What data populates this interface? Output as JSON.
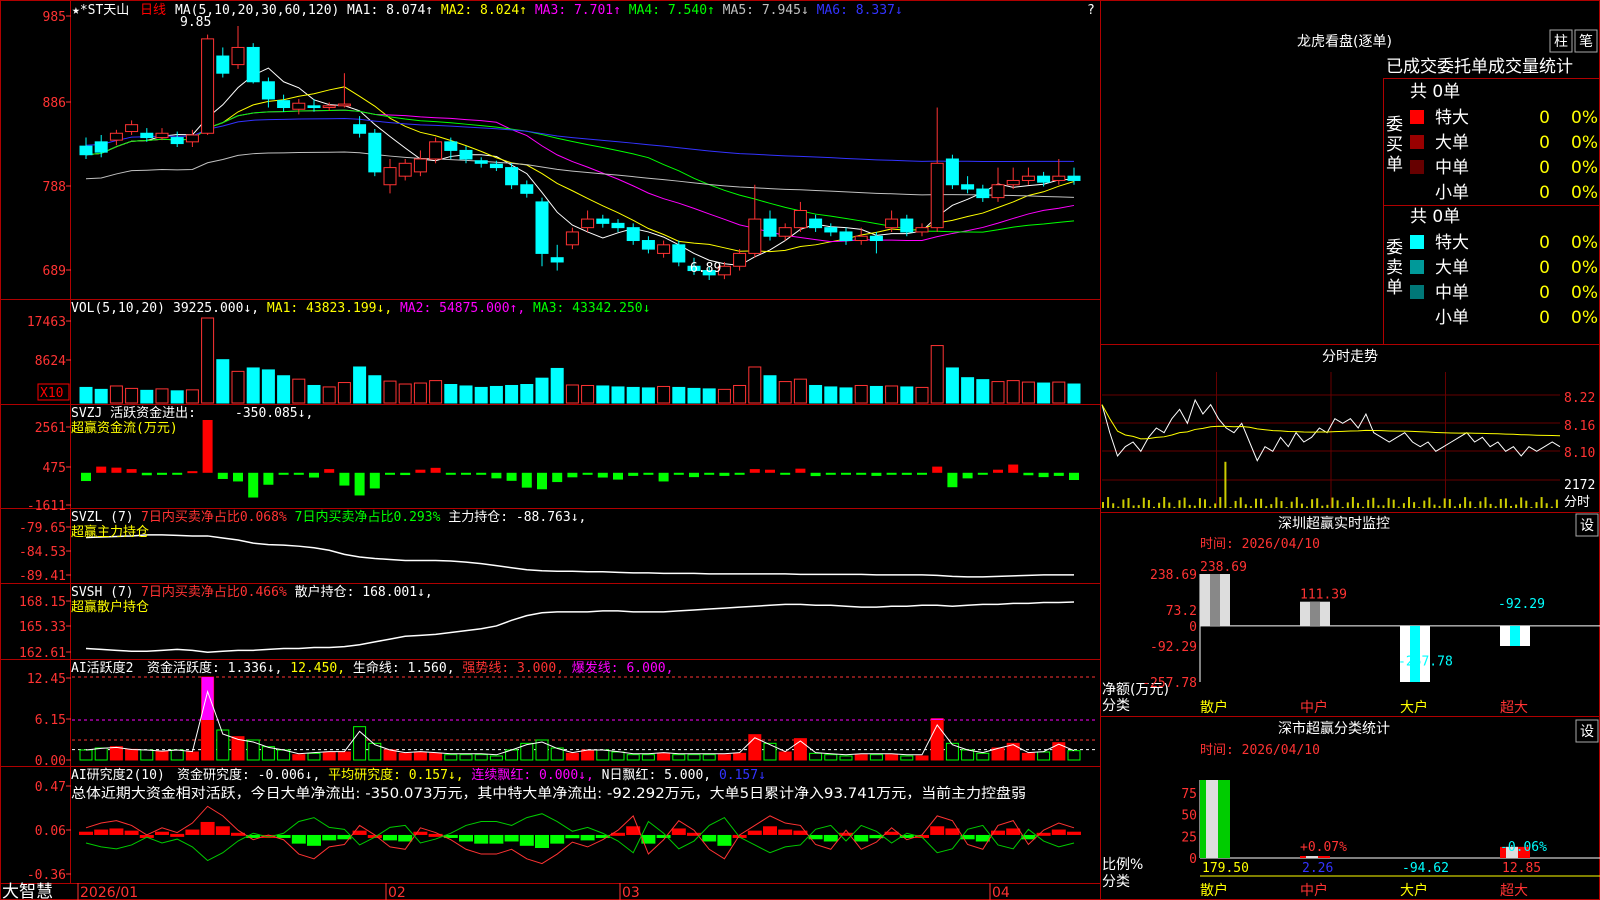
{
  "chart_data": [
    {
      "type": "candlestick",
      "panel": "price",
      "title_prefix": "★*ST天山",
      "period": "日线",
      "ma_label": "MA(5,10,20,30,60,120)",
      "ma_values": [
        {
          "text": "MA1: 8.074↑",
          "color": "#ffffff"
        },
        {
          "text": "MA2: 8.024↑",
          "color": "#ffff00"
        },
        {
          "text": "MA3: 7.701↑",
          "color": "#ff00ff"
        },
        {
          "text": "MA4: 7.540↑",
          "color": "#00ff00"
        },
        {
          "text": "MA5: 7.945↓",
          "color": "#c0c0c0"
        },
        {
          "text": "MA6: 8.337↓",
          "color": "#3333ff"
        }
      ],
      "y_ticks": [
        "985",
        "886",
        "788",
        "689"
      ],
      "y_range": [
        6.89,
        9.85
      ],
      "high_mark": "9.85",
      "low_mark": "6.89",
      "x_labels": [
        "2026/01",
        "02",
        "03",
        "04"
      ],
      "candles": [
        [
          8.45,
          8.35,
          8.55,
          8.3
        ],
        [
          8.5,
          8.38,
          8.58,
          8.32
        ],
        [
          8.52,
          8.6,
          8.64,
          8.46
        ],
        [
          8.62,
          8.7,
          8.75,
          8.58
        ],
        [
          8.6,
          8.55,
          8.66,
          8.5
        ],
        [
          8.55,
          8.6,
          8.66,
          8.52
        ],
        [
          8.55,
          8.48,
          8.62,
          8.44
        ],
        [
          8.5,
          8.58,
          8.64,
          8.44
        ],
        [
          8.6,
          9.7,
          9.75,
          8.58
        ],
        [
          9.5,
          9.3,
          9.6,
          9.25
        ],
        [
          9.4,
          9.6,
          9.85,
          9.35
        ],
        [
          9.6,
          9.2,
          9.65,
          9.18
        ],
        [
          9.2,
          9.0,
          9.25,
          8.9
        ],
        [
          8.98,
          8.9,
          9.05,
          8.85
        ],
        [
          8.88,
          8.95,
          9.0,
          8.82
        ],
        [
          8.92,
          8.9,
          9.0,
          8.85
        ],
        [
          8.9,
          8.92,
          8.96,
          8.86
        ],
        [
          8.92,
          8.94,
          9.3,
          8.9
        ],
        [
          8.7,
          8.6,
          8.8,
          8.55
        ],
        [
          8.6,
          8.15,
          8.65,
          8.1
        ],
        [
          8.0,
          8.2,
          8.3,
          7.9
        ],
        [
          8.1,
          8.25,
          8.3,
          8.05
        ],
        [
          8.15,
          8.3,
          8.4,
          8.1
        ],
        [
          8.3,
          8.5,
          8.55,
          8.25
        ],
        [
          8.5,
          8.4,
          8.55,
          8.3
        ],
        [
          8.4,
          8.3,
          8.45,
          8.25
        ],
        [
          8.28,
          8.25,
          8.32,
          8.2
        ],
        [
          8.24,
          8.2,
          8.28,
          8.16
        ],
        [
          8.2,
          8.0,
          8.25,
          7.95
        ],
        [
          8.0,
          7.9,
          8.05,
          7.85
        ],
        [
          7.8,
          7.2,
          7.85,
          7.05
        ],
        [
          7.15,
          7.1,
          7.3,
          7.0
        ],
        [
          7.3,
          7.45,
          7.5,
          7.25
        ],
        [
          7.5,
          7.6,
          7.7,
          7.45
        ],
        [
          7.6,
          7.55,
          7.65,
          7.5
        ],
        [
          7.55,
          7.5,
          7.6,
          7.45
        ],
        [
          7.5,
          7.35,
          7.55,
          7.3
        ],
        [
          7.35,
          7.25,
          7.4,
          7.2
        ],
        [
          7.2,
          7.3,
          7.35,
          7.15
        ],
        [
          7.3,
          7.1,
          7.35,
          7.05
        ],
        [
          7.05,
          7.0,
          7.15,
          6.95
        ],
        [
          7.0,
          6.95,
          7.05,
          6.89
        ],
        [
          6.95,
          7.05,
          7.1,
          6.9
        ],
        [
          7.05,
          7.2,
          7.25,
          7.0
        ],
        [
          7.2,
          7.6,
          8.0,
          7.15
        ],
        [
          7.6,
          7.4,
          7.7,
          7.35
        ],
        [
          7.4,
          7.5,
          7.55,
          7.35
        ],
        [
          7.5,
          7.7,
          7.8,
          7.45
        ],
        [
          7.6,
          7.5,
          7.65,
          7.45
        ],
        [
          7.5,
          7.45,
          7.55,
          7.4
        ],
        [
          7.45,
          7.35,
          7.5,
          7.3
        ],
        [
          7.35,
          7.4,
          7.5,
          7.3
        ],
        [
          7.4,
          7.35,
          7.45,
          7.2
        ],
        [
          7.5,
          7.6,
          7.7,
          7.45
        ],
        [
          7.6,
          7.45,
          7.65,
          7.4
        ],
        [
          7.45,
          7.5,
          7.55,
          7.4
        ],
        [
          7.5,
          8.25,
          8.9,
          7.45
        ],
        [
          8.3,
          8.0,
          8.35,
          7.95
        ],
        [
          8.0,
          7.95,
          8.1,
          7.9
        ],
        [
          7.95,
          7.85,
          8.0,
          7.8
        ],
        [
          7.85,
          8.0,
          8.2,
          7.8
        ],
        [
          8.0,
          8.05,
          8.2,
          7.95
        ],
        [
          8.05,
          8.1,
          8.2,
          8.0
        ],
        [
          8.1,
          8.03,
          8.15,
          7.98
        ],
        [
          8.05,
          8.1,
          8.3,
          8.0
        ],
        [
          8.1,
          8.05,
          8.2,
          8.0
        ]
      ]
    },
    {
      "type": "bar",
      "panel": "volume",
      "label": "VOL(5,10,20)",
      "segments": [
        {
          "text": "39225.000↓,",
          "color": "#ffffff"
        },
        {
          "text": "MA1: 43823.199↓,",
          "color": "#ffff00"
        },
        {
          "text": "MA2: 54875.000↑,",
          "color": "#ff00ff"
        },
        {
          "text": "MA3: 43342.250↓",
          "color": "#00ff00"
        }
      ],
      "y_ticks": [
        "17463",
        "8624"
      ],
      "unit": "X10",
      "y_range": [
        0,
        17463
      ],
      "values": [
        3200,
        2800,
        3500,
        3000,
        2600,
        2900,
        2500,
        2700,
        17463,
        8900,
        6500,
        7200,
        6800,
        5600,
        4900,
        3600,
        3300,
        4200,
        7400,
        5600,
        4500,
        3900,
        4100,
        4600,
        3800,
        3500,
        3200,
        3400,
        3600,
        3800,
        5100,
        7100,
        3700,
        3600,
        3500,
        3300,
        3200,
        3100,
        3400,
        3200,
        3000,
        2900,
        2800,
        3600,
        7400,
        5600,
        4400,
        4900,
        3600,
        3300,
        3100,
        3600,
        3400,
        3500,
        3300,
        3200,
        11800,
        7200,
        5200,
        4800,
        4400,
        4600,
        4300,
        4100,
        4300,
        3900
      ]
    },
    {
      "type": "bar",
      "panel": "svzj",
      "label": "SVZJ  活跃资金进出:",
      "value_text": "-350.085↓,",
      "subtitle": "超赢资金流(万元)",
      "y_ticks": [
        "2561",
        "475",
        "-1611"
      ],
      "y_range": [
        -1611,
        2561
      ],
      "values": [
        -400,
        300,
        250,
        180,
        -120,
        -100,
        -90,
        80,
        2561,
        -300,
        -420,
        -1200,
        -580,
        -60,
        -50,
        -230,
        180,
        -620,
        -1100,
        -760,
        -60,
        -110,
        150,
        240,
        -40,
        -60,
        -60,
        -270,
        -390,
        -720,
        -800,
        -450,
        -220,
        -90,
        -230,
        -330,
        -150,
        -70,
        -420,
        -60,
        -210,
        -60,
        -150,
        -90,
        180,
        150,
        -60,
        200,
        -160,
        -90,
        -70,
        -60,
        -150,
        -80,
        -100,
        -60,
        300,
        -700,
        -270,
        -50,
        150,
        400,
        -120,
        -210,
        -150,
        -350
      ]
    },
    {
      "type": "line",
      "panel": "svzl",
      "label": "SVZL (7)",
      "segments": [
        {
          "text": "7日内买卖净占比0.068%",
          "color": "#ff3333"
        },
        {
          "text": "7日内买卖净占比0.293%",
          "color": "#00ff00"
        },
        {
          "text": "主力持仓: -88.763↓,",
          "color": "#ffffff"
        }
      ],
      "subtitle": "超赢主力持仓",
      "y_ticks": [
        "-79.65",
        "-84.53",
        "-89.41"
      ],
      "y_range": [
        -89.41,
        -79.65
      ],
      "values": [
        -81.5,
        -81.4,
        -81.3,
        -81.2,
        -81.0,
        -81.0,
        -81.1,
        -81.2,
        -81.2,
        -81.6,
        -82.0,
        -82.6,
        -82.9,
        -83.0,
        -83.2,
        -83.5,
        -84.0,
        -84.8,
        -85.3,
        -85.6,
        -85.8,
        -86.0,
        -86.0,
        -86.0,
        -86.1,
        -86.3,
        -86.6,
        -87.0,
        -87.4,
        -87.8,
        -88.0,
        -88.1,
        -88.1,
        -88.2,
        -88.2,
        -88.3,
        -88.4,
        -88.4,
        -88.5,
        -88.5,
        -88.5,
        -88.6,
        -88.6,
        -88.6,
        -88.6,
        -88.6,
        -88.6,
        -88.7,
        -88.7,
        -88.7,
        -88.7,
        -88.7,
        -88.8,
        -88.8,
        -88.8,
        -88.8,
        -88.9,
        -89.1,
        -89.2,
        -89.2,
        -89.1,
        -89.0,
        -88.9,
        -88.8,
        -88.8,
        -88.8
      ]
    },
    {
      "type": "line",
      "panel": "svsh",
      "label": "SVSH (7)",
      "segments": [
        {
          "text": "7日内买卖净占比0.466%",
          "color": "#ff3333"
        },
        {
          "text": "散户持仓: 168.001↓,",
          "color": "#ffffff"
        }
      ],
      "subtitle": "超赢散户持仓",
      "y_ticks": [
        "168.15",
        "165.33",
        "162.61"
      ],
      "y_range": [
        162.61,
        168.15
      ],
      "values": [
        163.2,
        163.1,
        163.0,
        162.9,
        162.9,
        163.0,
        163.1,
        163.0,
        162.8,
        162.9,
        163.0,
        163.0,
        163.1,
        163.2,
        163.2,
        163.3,
        163.3,
        163.4,
        163.6,
        163.9,
        164.2,
        164.5,
        164.6,
        164.7,
        164.9,
        165.1,
        165.3,
        165.6,
        166.2,
        166.7,
        167.0,
        167.1,
        167.1,
        167.1,
        167.2,
        167.2,
        167.1,
        167.1,
        167.1,
        167.2,
        167.3,
        167.4,
        167.5,
        167.6,
        167.7,
        167.8,
        167.9,
        167.9,
        167.8,
        167.8,
        167.7,
        167.6,
        167.6,
        167.7,
        167.7,
        167.8,
        167.8,
        167.7,
        167.8,
        167.9,
        167.9,
        168.0,
        168.0,
        168.1,
        168.1,
        168.15
      ]
    },
    {
      "type": "bar",
      "panel": "ai_activity",
      "label": "AI活跃度2",
      "segments": [
        {
          "text": "资金活跃度: 1.336↓,",
          "color": "#ffffff"
        },
        {
          "text": "12.450,",
          "color": "#ffff00"
        },
        {
          "text": "生命线: 1.560,",
          "color": "#ffffff"
        },
        {
          "text": "强势线: 3.000,",
          "color": "#ff3333"
        },
        {
          "text": "爆发线: 6.000,",
          "color": "#ff00ff"
        }
      ],
      "y_ticks": [
        "12.45",
        "6.15",
        "0.00"
      ],
      "y_range": [
        0,
        12.45
      ],
      "lines": [
        1.56,
        3.0,
        6.0,
        12.45
      ],
      "values": [
        1.5,
        1.8,
        2.0,
        1.6,
        1.5,
        1.3,
        1.5,
        1.2,
        12.45,
        4.5,
        3.5,
        3.0,
        2.0,
        1.5,
        0.8,
        1.0,
        1.2,
        1.2,
        5.0,
        2.5,
        1.5,
        1.0,
        1.2,
        1.0,
        0.8,
        0.8,
        0.8,
        0.6,
        1.5,
        2.5,
        3.0,
        1.8,
        1.0,
        1.5,
        1.5,
        1.2,
        0.8,
        0.8,
        1.0,
        0.8,
        0.8,
        0.8,
        0.8,
        1.0,
        3.8,
        2.5,
        1.2,
        3.2,
        1.0,
        0.8,
        0.6,
        0.8,
        0.8,
        0.8,
        0.6,
        0.6,
        6.2,
        2.5,
        1.5,
        1.0,
        1.8,
        2.5,
        1.0,
        1.2,
        2.6,
        1.4
      ]
    },
    {
      "type": "bar",
      "panel": "ai_research",
      "label": "AI研究度2(10)",
      "segments": [
        {
          "text": "资金研究度: -0.006↓,",
          "color": "#ffffff"
        },
        {
          "text": "平均研究度: 0.157↓,",
          "color": "#ffff00"
        },
        {
          "text": "连续飘红: 0.000↓,",
          "color": "#ff00ff"
        },
        {
          "text": "N日飘红: 5.000,",
          "color": "#ffffff"
        },
        {
          "text": "0.157↓",
          "color": "#3333ff"
        }
      ],
      "summary": "总体近期大资金相对活跃，今日大单净流出: -350.073万元，其中特大单净流出: -92.292万元，大单5日累计净入93.741万元，当前主力控盘弱",
      "y_ticks": [
        "0.47",
        "0.06",
        "-0.36"
      ],
      "y_range": [
        -0.36,
        0.47
      ],
      "values": [
        0.03,
        0.05,
        0.06,
        0.04,
        0.0,
        0.03,
        0.01,
        0.05,
        0.12,
        0.08,
        0.02,
        -0.02,
        0.0,
        -0.02,
        -0.08,
        -0.1,
        -0.05,
        -0.04,
        0.04,
        0.0,
        -0.05,
        -0.06,
        0.03,
        0.01,
        -0.02,
        -0.06,
        -0.08,
        -0.08,
        -0.06,
        -0.1,
        -0.12,
        -0.08,
        -0.03,
        -0.05,
        -0.02,
        0.02,
        0.08,
        -0.08,
        -0.02,
        0.06,
        0.02,
        -0.06,
        -0.1,
        0.0,
        0.04,
        0.08,
        0.05,
        0.04,
        -0.04,
        -0.06,
        0.02,
        -0.06,
        -0.03,
        0.03,
        -0.02,
        0.0,
        0.08,
        0.06,
        -0.04,
        -0.06,
        0.04,
        0.06,
        -0.04,
        0.02,
        0.05,
        0.03
      ]
    },
    {
      "type": "line",
      "panel": "intraday",
      "title": "分时走势",
      "y_ticks": [
        "8.22",
        "8.16",
        "8.10",
        "2172"
      ],
      "time_label": "分时",
      "price_range": [
        8.04,
        8.25
      ],
      "values": [
        8.18,
        8.12,
        8.07,
        8.09,
        8.1,
        8.08,
        8.11,
        8.13,
        8.12,
        8.15,
        8.17,
        8.14,
        8.19,
        8.16,
        8.18,
        8.15,
        8.13,
        8.12,
        8.14,
        8.1,
        8.06,
        8.09,
        8.08,
        8.11,
        8.09,
        8.12,
        8.1,
        8.11,
        8.13,
        8.12,
        8.15,
        8.14,
        8.15,
        8.13,
        8.16,
        8.12,
        8.11,
        8.1,
        8.11,
        8.12,
        8.1,
        8.09,
        8.1,
        8.08,
        8.09,
        8.1,
        8.11,
        8.12,
        8.1,
        8.11,
        8.09,
        8.1,
        8.08,
        8.09,
        8.07,
        8.09,
        8.08,
        8.09,
        8.1,
        8.09
      ]
    },
    {
      "type": "bar",
      "panel": "szcy_monitor",
      "title": "深圳超赢实时监控",
      "time": "时间: 2026/04/10",
      "y_ticks": [
        "238.69",
        "73.2",
        "0",
        "-92.29",
        "-257.78"
      ],
      "ylabel": "净额(万元)",
      "xlabel": "分类",
      "categories": [
        "散户",
        "中户",
        "大户",
        "超大"
      ],
      "values": [
        238.69,
        111.39,
        -257.78,
        -92.29
      ],
      "value_labels": [
        "238.69",
        "111.39",
        "-257.78",
        "-92.29"
      ]
    },
    {
      "type": "bar",
      "panel": "szcy_category",
      "title": "深市超赢分类统计",
      "time": "时间: 2026/04/10",
      "y_ticks": [
        "75",
        "50",
        "25",
        "0"
      ],
      "ylabel": "比例%",
      "xlabel": "分类",
      "categories": [
        "散户",
        "中户",
        "大户",
        "超大"
      ],
      "values": [
        179.5,
        2.26,
        -94.62,
        12.85
      ],
      "value_labels": [
        "179.50",
        "2.26",
        "-94.62",
        "12.85"
      ],
      "pct_labels": [
        "",
        "+0.07%",
        "",
        "-0.06%"
      ]
    }
  ],
  "dragon_tiger": {
    "title": "龙虎看盘(逐单)",
    "btn_zhu": "柱",
    "btn_bi": "笔",
    "header": "已成交委托单成交量统计",
    "buy_label": "委买单",
    "sell_label": "委卖单",
    "buy_total": "共 0单",
    "sell_total": "共 0单",
    "buy_rows": [
      {
        "name": "特大",
        "count": "0",
        "pct": "0%",
        "color": "#ff0000"
      },
      {
        "name": "大单",
        "count": "0",
        "pct": "0%",
        "color": "#990000"
      },
      {
        "name": "中单",
        "count": "0",
        "pct": "0%",
        "color": "#660000"
      },
      {
        "name": "小单",
        "count": "0",
        "pct": "0%",
        "color": ""
      }
    ],
    "sell_rows": [
      {
        "name": "特大",
        "count": "0",
        "pct": "0%",
        "color": "#00ffff"
      },
      {
        "name": "大单",
        "count": "0",
        "pct": "0%",
        "color": "#009999"
      },
      {
        "name": "中单",
        "count": "0",
        "pct": "0%",
        "color": "#007777"
      },
      {
        "name": "小单",
        "count": "0",
        "pct": "0%",
        "color": ""
      }
    ]
  },
  "settings_label": "设",
  "brand": "大智慧",
  "help_label": "?",
  "colors": {
    "up": "#ff0000",
    "down": "#00ffff",
    "green": "#00ff00",
    "frame": "#cc0000",
    "yellow": "#ffff00",
    "magenta": "#ff00ff"
  }
}
